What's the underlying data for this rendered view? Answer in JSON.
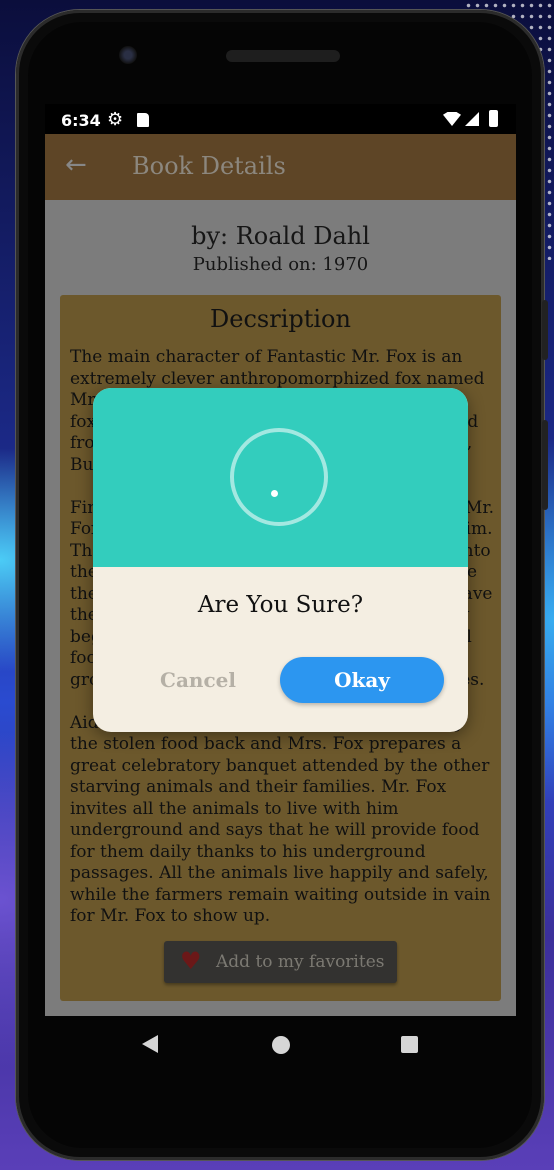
{
  "status_bar": {
    "time": "6:34",
    "icons": [
      "gear-icon",
      "sd-card-icon",
      "wifi-icon",
      "signal-icon",
      "battery-icon"
    ]
  },
  "app_bar": {
    "back_icon": "arrow-left-icon",
    "title": "Book Details"
  },
  "book": {
    "author": "by: Roald Dahl",
    "published": "Published on: 1970",
    "description_heading": "Decsription",
    "description": "The main character of Fantastic Mr. Fox is an extremely clever anthropomorphized fox named Mr. Fox. He lives with his wife and four little foxes. In order to feed his family, he steals food from the cruel, brutish farmers named Boggis, Bunce, and Bean every night.\n\nFinally tired of being constantly outwitted by Mr. Fox, the farmers attempt to capture and kill him. The foxes escape in time by burrowing deep into the ground. The farmers decide to wait outside the hole for the foxes to emerge. Unable to leave the hole and steal food, Mr. Fox and his family begin to starve. Mr. Fox devises a plan to steal food from the farmers by tunneling into the ground and borrowing into the farmer's houses.\n\nAided by a friendly Badger, the animals bring the stolen food back and Mrs. Fox prepares a great celebratory banquet attended by the other starving animals and their families. Mr. Fox invites all the animals to live with him underground and says that he will provide food for them daily thanks to his underground passages. All the animals live happily and safely, while the farmers remain waiting outside in vain for Mr. Fox to show up.",
    "favorite_button": "Add to my favorites",
    "favorite_icon": "heart-icon"
  },
  "dialog": {
    "question": "Are You Sure?",
    "cancel_label": "Cancel",
    "okay_label": "Okay",
    "header_color": "#33cdbd",
    "okay_color": "#2c96f0"
  },
  "nav_bar": {
    "icons": [
      "back-triangle-icon",
      "home-circle-icon",
      "recents-square-icon"
    ]
  }
}
